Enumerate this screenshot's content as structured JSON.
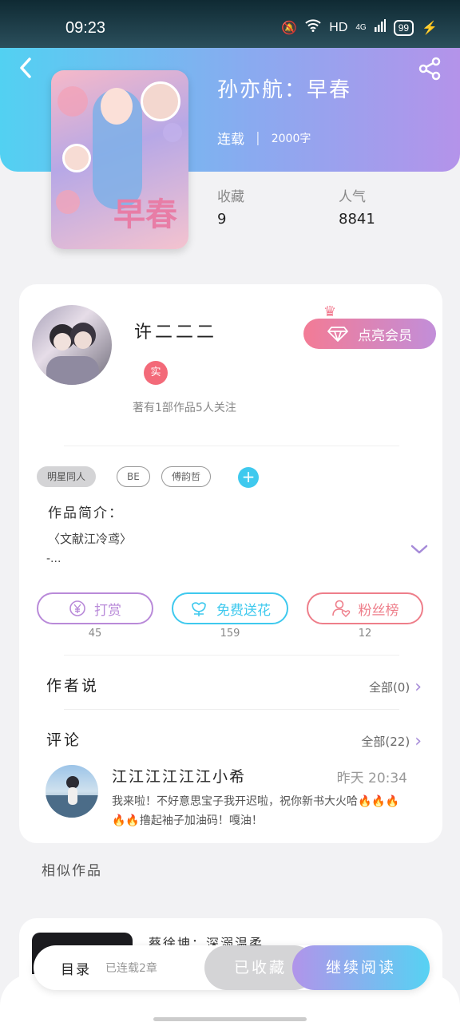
{
  "status_bar": {
    "time": "09:23",
    "network": "HD",
    "signal": "4G",
    "battery": "99"
  },
  "book": {
    "title": "孙亦航：早春",
    "status": "连载",
    "separator": "|",
    "words": "2000字",
    "cover_title": "早春",
    "stats": [
      {
        "label": "收藏",
        "value": "9"
      },
      {
        "label": "人气",
        "value": "8841"
      }
    ]
  },
  "author": {
    "name": "许二二二",
    "badge": "实",
    "meta": "著有1部作品5人关注",
    "vip_label": "点亮会员"
  },
  "tags": [
    "明星同人",
    "BE",
    "傅韵哲"
  ],
  "intro": {
    "label": "作品简介：",
    "line1": "〈文献江冷鸢〉",
    "line2": "-..."
  },
  "actions": [
    {
      "label": "打赏",
      "count": "45",
      "color": "#b98ad9"
    },
    {
      "label": "免费送花",
      "count": "159",
      "color": "#3fc9ee"
    },
    {
      "label": "粉丝榜",
      "count": "12",
      "color": "#ee7e8a"
    }
  ],
  "author_says": {
    "title": "作者说",
    "more": "全部(0)"
  },
  "comments": {
    "title": "评论",
    "more": "全部(22)",
    "item": {
      "user": "江江江江江江小希",
      "time": "昨天 20:34",
      "text": "我来啦！不好意思宝子我开迟啦，祝你新书大火哈🔥🔥🔥🔥🔥撸起袖子加油码！嘎油！"
    }
  },
  "similar": {
    "title": "相似作品",
    "first_name": "蔡徐坤：深溺温柔"
  },
  "bottom": {
    "toc": "目录",
    "toc_status": "已连载2章",
    "collected": "已收藏",
    "read": "继续阅读"
  }
}
